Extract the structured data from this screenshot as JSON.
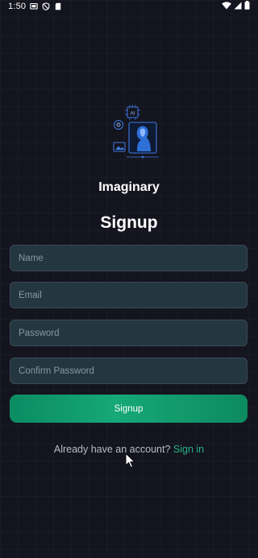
{
  "status_bar": {
    "time": "1:50",
    "icons": [
      "screen-cast-icon",
      "shield-icon",
      "sd-card-icon",
      "wifi-icon",
      "cell-signal-icon",
      "battery-icon"
    ]
  },
  "app": {
    "brand_name": "Imaginary",
    "page_title": "Signup",
    "illustration": "ai-portrait-illustration"
  },
  "form": {
    "name_placeholder": "Name",
    "email_placeholder": "Email",
    "password_placeholder": "Password",
    "confirm_password_placeholder": "Confirm Password",
    "name_value": "",
    "email_value": "",
    "password_value": "",
    "confirm_password_value": "",
    "submit_label": "Signup"
  },
  "footer": {
    "prompt": "Already have an account?",
    "link_label": "Sign in"
  },
  "colors": {
    "background": "#14141f",
    "field_background": "#243640",
    "accent": "#16a877",
    "link": "#23b383"
  }
}
